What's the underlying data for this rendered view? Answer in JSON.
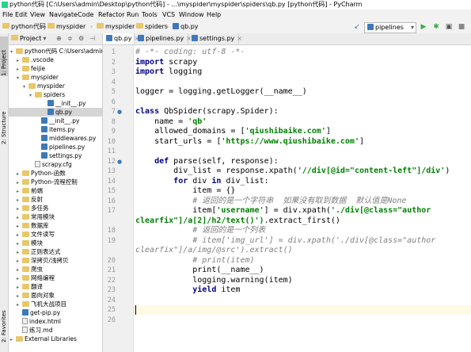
{
  "window": {
    "title": "python代码 [C:\\Users\\admin\\Desktop\\python代码] - ...\\myspider\\myspider\\spiders\\qb.py [python代码] - PyCharm"
  },
  "menu": [
    "File",
    "Edit",
    "View",
    "Navigate",
    "Code",
    "Refactor",
    "Run",
    "Tools",
    "VCS",
    "Window",
    "Help"
  ],
  "breadcrumb": [
    "python代码",
    "myspider",
    "myspider",
    "spiders",
    "qb.py"
  ],
  "run_config": "pipelines",
  "left_tabs": [
    "1: Project",
    "2: Structure",
    "2: Favorites"
  ],
  "project_panel": {
    "title": "Project"
  },
  "tree": [
    {
      "label": "python代码  C:\\Users\\admin",
      "type": "folder",
      "arrow": "▾"
    },
    {
      "label": ".vscode",
      "type": "folder",
      "arrow": "▸"
    },
    {
      "label": "feijie",
      "type": "folder",
      "arrow": "▸"
    },
    {
      "label": "myspider",
      "type": "folder",
      "arrow": "▾"
    },
    {
      "label": "myspider",
      "type": "folder",
      "arrow": "▾"
    },
    {
      "label": "spiders",
      "type": "folder",
      "arrow": "▾"
    },
    {
      "label": "__init__.py",
      "type": "py",
      "arrow": ""
    },
    {
      "label": "qb.py",
      "type": "py",
      "arrow": "",
      "selected": true
    },
    {
      "label": "__init__.py",
      "type": "py",
      "arrow": ""
    },
    {
      "label": "items.py",
      "type": "py",
      "arrow": ""
    },
    {
      "label": "middlewares.py",
      "type": "py",
      "arrow": ""
    },
    {
      "label": "pipelines.py",
      "type": "py",
      "arrow": ""
    },
    {
      "label": "settings.py",
      "type": "py",
      "arrow": ""
    },
    {
      "label": "scrapy.cfg",
      "type": "file",
      "arrow": ""
    },
    {
      "label": "Python-函数",
      "type": "folder",
      "arrow": "▸"
    },
    {
      "label": "Python-流程控制",
      "type": "folder",
      "arrow": "▸"
    },
    {
      "label": "前端",
      "type": "folder",
      "arrow": "▸"
    },
    {
      "label": "反射",
      "type": "folder",
      "arrow": "▸"
    },
    {
      "label": "多任务",
      "type": "folder",
      "arrow": "▸"
    },
    {
      "label": "常用模块",
      "type": "folder",
      "arrow": "▸"
    },
    {
      "label": "数据库",
      "type": "folder",
      "arrow": "▸"
    },
    {
      "label": "文件读写",
      "type": "folder",
      "arrow": "▸"
    },
    {
      "label": "模块",
      "type": "folder",
      "arrow": "▸"
    },
    {
      "label": "正则表达式",
      "type": "folder",
      "arrow": "▸"
    },
    {
      "label": "深拷贝/浅拷贝",
      "type": "folder",
      "arrow": "▸"
    },
    {
      "label": "爬虫",
      "type": "folder",
      "arrow": "▸"
    },
    {
      "label": "网络编程",
      "type": "folder",
      "arrow": "▸"
    },
    {
      "label": "翻译",
      "type": "folder",
      "arrow": "▸"
    },
    {
      "label": "面向对象",
      "type": "folder",
      "arrow": "▸"
    },
    {
      "label": "飞机大战项目",
      "type": "folder",
      "arrow": "▸"
    },
    {
      "label": "get-pip.py",
      "type": "py",
      "arrow": ""
    },
    {
      "label": "index.html",
      "type": "file",
      "arrow": ""
    },
    {
      "label": "练习.md",
      "type": "file",
      "arrow": ""
    },
    {
      "label": "External Libraries",
      "type": "folder",
      "arrow": "▸"
    }
  ],
  "tabs": [
    {
      "label": "qb.py",
      "active": true
    },
    {
      "label": "pipelines.py",
      "active": false
    },
    {
      "label": "settings.py",
      "active": false
    }
  ],
  "code": [
    {
      "n": "1",
      "t": "# -*- coding: utf-8 -*-"
    },
    {
      "n": "2",
      "t": "import scrapy"
    },
    {
      "n": "3",
      "t": "import logging"
    },
    {
      "n": "4",
      "t": ""
    },
    {
      "n": "5",
      "t": "logger = logging.getLogger(__name__)"
    },
    {
      "n": "6",
      "t": ""
    },
    {
      "n": "7",
      "t": "class QbSpider(scrapy.Spider):"
    },
    {
      "n": "8",
      "t": "    name = 'qb'"
    },
    {
      "n": "9",
      "t": "    allowed_domains = ['qiushibaike.com']"
    },
    {
      "n": "10",
      "t": "    start_urls = ['https://www.qiushibaike.com']"
    },
    {
      "n": "11",
      "t": ""
    },
    {
      "n": "12",
      "t": "    def parse(self, response):"
    },
    {
      "n": "13",
      "t": "        div_list = response.xpath('//div[@id=\"content-left\"]/div')"
    },
    {
      "n": "14",
      "t": "        for div in div_list:"
    },
    {
      "n": "15",
      "t": "            item = {}"
    },
    {
      "n": "16",
      "t": "            # 返回的是一个字符串  如果没有取到数据  默认值是None"
    },
    {
      "n": "17",
      "t": "            item['username'] = div.xpath('./div[@class=\"author"
    },
    {
      "n": "",
      "t": "clearfix\"]/a[2]/h2/text()').extract_first()"
    },
    {
      "n": "18",
      "t": "            # 返回的是一个列表"
    },
    {
      "n": "19",
      "t": "            # item['img_url'] = div.xpath('./div[@class=\"author"
    },
    {
      "n": "",
      "t": "clearfix\"]/a/img/@src').extract()"
    },
    {
      "n": "20",
      "t": "            # print(item)"
    },
    {
      "n": "21",
      "t": "            print(__name__)"
    },
    {
      "n": "22",
      "t": "            logging.warning(item)"
    },
    {
      "n": "23",
      "t": "            yield item"
    },
    {
      "n": "24",
      "t": ""
    },
    {
      "n": "25",
      "t": ""
    },
    {
      "n": "26",
      "t": ""
    }
  ]
}
